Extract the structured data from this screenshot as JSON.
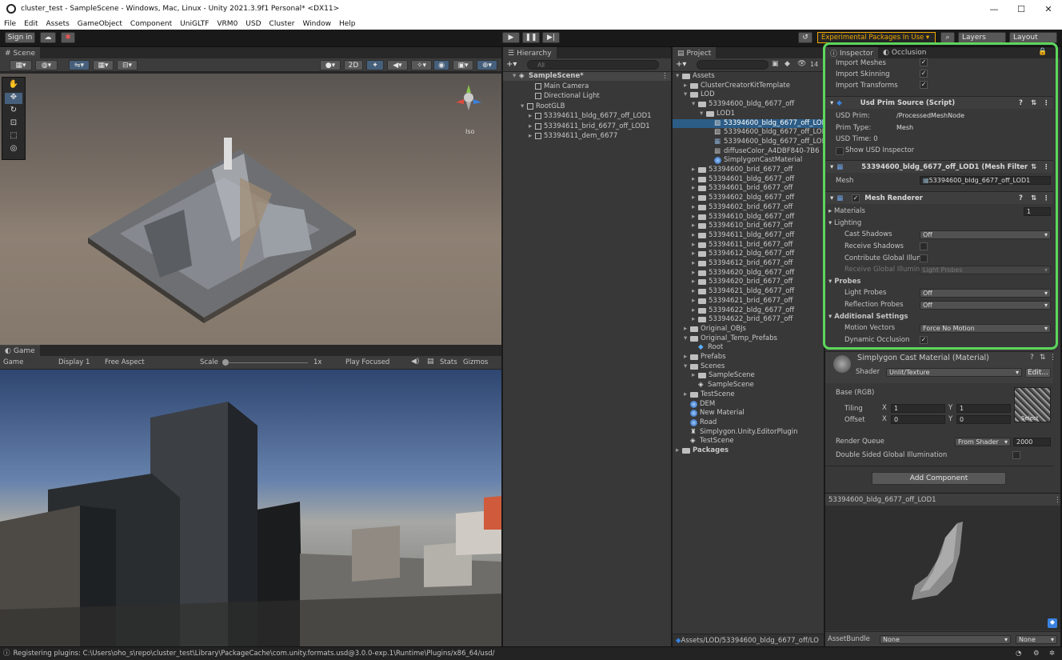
{
  "window": {
    "title": "cluster_test - SampleScene - Windows, Mac, Linux - Unity 2021.3.9f1 Personal* <DX11>"
  },
  "menu": [
    "File",
    "Edit",
    "Assets",
    "GameObject",
    "Component",
    "UniGLTF",
    "VRM0",
    "USD",
    "Cluster",
    "Window",
    "Help"
  ],
  "toolbar": {
    "sign_in": "Sign in",
    "experimental": "Experimental Packages In Use ▾",
    "layers": "Layers",
    "layout": "Layout"
  },
  "scene": {
    "tab": "Scene",
    "btn_2d": "2D",
    "iso_label": "Iso"
  },
  "game": {
    "tab": "Game",
    "mode": "Game",
    "display": "Display 1",
    "aspect": "Free Aspect",
    "scale_label": "Scale",
    "scale_value": "1x",
    "play_focused": "Play Focused",
    "stats": "Stats",
    "gizmos": "Gizmos"
  },
  "hierarchy": {
    "tab": "Hierarchy",
    "search_placeholder": "All",
    "items": [
      {
        "label": "SampleScene*",
        "indent": 0,
        "icon": "unity",
        "bold": true
      },
      {
        "label": "Main Camera",
        "indent": 2,
        "icon": "cube"
      },
      {
        "label": "Directional Light",
        "indent": 2,
        "icon": "cube"
      },
      {
        "label": "RootGLB",
        "indent": 1,
        "icon": "cube"
      },
      {
        "label": "53394611_bldg_6677_off_LOD1",
        "indent": 2,
        "icon": "cube"
      },
      {
        "label": "53394611_brid_6677_off_LOD1",
        "indent": 2,
        "icon": "cube"
      },
      {
        "label": "53394611_dem_6677",
        "indent": 2,
        "icon": "cube"
      }
    ]
  },
  "project": {
    "tab": "Project",
    "count": "14",
    "items": [
      {
        "label": "Assets",
        "indent": 0,
        "icon": "folder",
        "open": true
      },
      {
        "label": "ClusterCreatorKitTemplate",
        "indent": 1,
        "icon": "folder"
      },
      {
        "label": "LOD",
        "indent": 1,
        "icon": "folder",
        "open": true
      },
      {
        "label": "53394600_bldg_6677_off",
        "indent": 2,
        "icon": "folder",
        "open": true
      },
      {
        "label": "LOD1",
        "indent": 3,
        "icon": "folder",
        "open": true
      },
      {
        "label": "53394600_bldg_6677_off_LOD1",
        "indent": 4,
        "icon": "mesh",
        "selected": true
      },
      {
        "label": "53394600_bldg_6677_off_LOD1",
        "indent": 4,
        "icon": "mesh"
      },
      {
        "label": "53394600_bldg_6677_off_LOD1",
        "indent": 4,
        "icon": "grid"
      },
      {
        "label": "diffuseColor_A4DBF840-7B6",
        "indent": 4,
        "icon": "tex"
      },
      {
        "label": "SimplygonCastMaterial",
        "indent": 4,
        "icon": "mat"
      },
      {
        "label": "53394600_brid_6677_off",
        "indent": 2,
        "icon": "folder"
      },
      {
        "label": "53394601_bldg_6677_off",
        "indent": 2,
        "icon": "folder"
      },
      {
        "label": "53394601_brid_6677_off",
        "indent": 2,
        "icon": "folder"
      },
      {
        "label": "53394602_bldg_6677_off",
        "indent": 2,
        "icon": "folder"
      },
      {
        "label": "53394602_brid_6677_off",
        "indent": 2,
        "icon": "folder"
      },
      {
        "label": "53394610_bldg_6677_off",
        "indent": 2,
        "icon": "folder"
      },
      {
        "label": "53394610_brid_6677_off",
        "indent": 2,
        "icon": "folder"
      },
      {
        "label": "53394611_bldg_6677_off",
        "indent": 2,
        "icon": "folder"
      },
      {
        "label": "53394611_brid_6677_off",
        "indent": 2,
        "icon": "folder"
      },
      {
        "label": "53394612_bldg_6677_off",
        "indent": 2,
        "icon": "folder"
      },
      {
        "label": "53394612_brid_6677_off",
        "indent": 2,
        "icon": "folder"
      },
      {
        "label": "53394620_bldg_6677_off",
        "indent": 2,
        "icon": "folder"
      },
      {
        "label": "53394620_brid_6677_off",
        "indent": 2,
        "icon": "folder"
      },
      {
        "label": "53394621_bldg_6677_off",
        "indent": 2,
        "icon": "folder"
      },
      {
        "label": "53394621_brid_6677_off",
        "indent": 2,
        "icon": "folder"
      },
      {
        "label": "53394622_bldg_6677_off",
        "indent": 2,
        "icon": "folder"
      },
      {
        "label": "53394622_brid_6677_off",
        "indent": 2,
        "icon": "folder"
      },
      {
        "label": "Original_OBJs",
        "indent": 1,
        "icon": "folder"
      },
      {
        "label": "Original_Temp_Prefabs",
        "indent": 1,
        "icon": "folder",
        "open": true
      },
      {
        "label": "Root",
        "indent": 2,
        "icon": "prefab"
      },
      {
        "label": "Prefabs",
        "indent": 1,
        "icon": "folder"
      },
      {
        "label": "Scenes",
        "indent": 1,
        "icon": "folder",
        "open": true
      },
      {
        "label": "SampleScene",
        "indent": 2,
        "icon": "folder"
      },
      {
        "label": "SampleScene",
        "indent": 2,
        "icon": "unity"
      },
      {
        "label": "TestScene",
        "indent": 1,
        "icon": "folder"
      },
      {
        "label": "DEM",
        "indent": 1,
        "icon": "mat"
      },
      {
        "label": "New Material",
        "indent": 1,
        "icon": "mat"
      },
      {
        "label": "Road",
        "indent": 1,
        "icon": "mat"
      },
      {
        "label": "Simplygon.Unity.EditorPlugin",
        "indent": 1,
        "icon": "plugin"
      },
      {
        "label": "TestScene",
        "indent": 1,
        "icon": "unity"
      },
      {
        "label": "Packages",
        "indent": 0,
        "icon": "folder",
        "bold": true
      }
    ],
    "path": "Assets/LOD/53394600_bldg_6677_off/LO"
  },
  "inspector": {
    "tab1": "Inspector",
    "tab2": "Occlusion",
    "import_rows": [
      "Import Meshes",
      "Import Skinning",
      "Import Transforms"
    ],
    "usd": {
      "title": "Usd Prim Source (Script)",
      "prim_label": "USD Prim:",
      "prim_value": "/ProcessedMeshNode",
      "type_label": "Prim Type:",
      "type_value": "Mesh",
      "time": "USD Time: 0",
      "show": "Show USD Inspector"
    },
    "meshfilter": {
      "title": "53394600_bldg_6677_off_LOD1 (Mesh Filter",
      "mesh_label": "Mesh",
      "mesh_value": "53394600_bldg_6677_off_LOD1"
    },
    "renderer": {
      "title": "Mesh Renderer",
      "materials": "Materials",
      "materials_count": "1",
      "lighting": "Lighting",
      "cast": "Cast Shadows",
      "cast_value": "Off",
      "receive": "Receive Shadows",
      "contribute": "Contribute Global Illum",
      "receive_gi": "Receive Global Illumina",
      "receive_gi_value": "Light Probes",
      "probes": "Probes",
      "light_probes": "Light Probes",
      "light_probes_value": "Off",
      "refl_probes": "Reflection Probes",
      "refl_probes_value": "Off",
      "additional": "Additional Settings",
      "motion": "Motion Vectors",
      "motion_value": "Force No Motion",
      "dynamic": "Dynamic Occlusion"
    },
    "material": {
      "title": "Simplygon Cast Material (Material)",
      "shader_label": "Shader",
      "shader_value": "Unlit/Texture",
      "edit": "Edit...",
      "base": "Base (RGB)",
      "tiling": "Tiling",
      "offset": "Offset",
      "x": "X",
      "y": "Y",
      "tx": "1",
      "ty": "1",
      "ox": "0",
      "oy": "0",
      "select": "Select",
      "queue_label": "Render Queue",
      "queue_mode": "From Shader",
      "queue_value": "2000",
      "double_sided": "Double Sided Global Illumination"
    },
    "add_component": "Add Component",
    "preview_title": "53394600_bldg_6677_off_LOD1",
    "assetbundle_label": "AssetBundle",
    "assetbundle_value": "None",
    "assetbundle_variant": "None"
  },
  "status": {
    "text": "Registering plugins: C:\\Users\\oho_s\\repo\\cluster_test\\Library\\PackageCache\\com.unity.formats.usd@3.0.0-exp.1\\Runtime\\Plugins/x86_64/usd/"
  },
  "colors": {
    "highlight": "#5dd65d",
    "selection": "#2c5d87",
    "experimental": "#f0a800"
  }
}
